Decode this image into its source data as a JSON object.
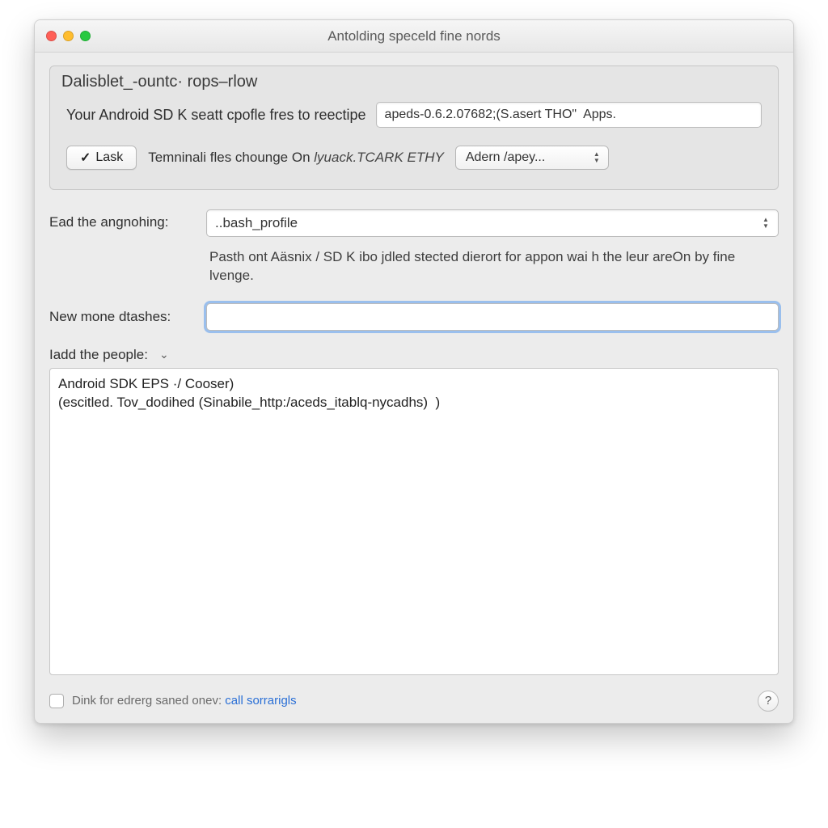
{
  "window": {
    "title": "Antolding speceld fine nords"
  },
  "group": {
    "legend": "Dalisblet_-ountc· rops–rlow",
    "sdk_label": "Your Android SD K seatt cpofle fres to reectipe",
    "sdk_value": "apeds-0.6.2.07682;(S.asert THO\"  Apps.",
    "lask_button": "Lask",
    "terminal_text_plain": "Temninali fles chounge On ",
    "terminal_text_mono": "lyuack.TCARK ETHY",
    "adem_select": "Adern /apey..."
  },
  "form": {
    "ead_label": "Ead the angnohing:",
    "ead_value": "..bash_profile",
    "helper": "Pasth ont Aäsnix / SD K  ibo  jdled stected dierort for appon wai h the leur areOn by fine lvenge.",
    "new_label": "New mone dtashes:",
    "new_value": "",
    "disclosure_label": "Iadd the people:",
    "textarea_value": "Android SDK EPS ·/ Cooser)\n(escitled. Tov_dodihed (Sinabile_http:/aceds_itablq-nycadhs)  )"
  },
  "footer": {
    "text_prefix": "Dink for edrerg saned onev: ",
    "link_text": "call sorrarigls",
    "help_label": "?"
  }
}
